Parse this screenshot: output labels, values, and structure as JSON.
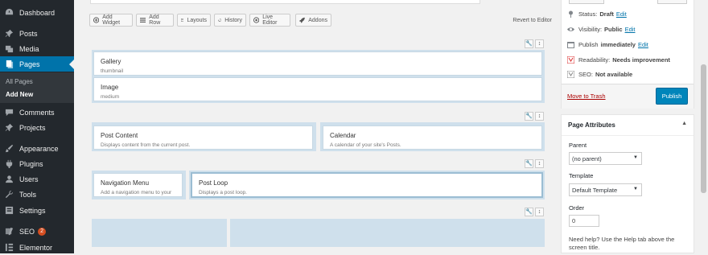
{
  "sidebar": {
    "items": [
      {
        "label": "Dashboard",
        "icon": "dashboard-icon"
      },
      {
        "label": "Posts",
        "icon": "pin-icon"
      },
      {
        "label": "Media",
        "icon": "media-icon"
      },
      {
        "label": "Pages",
        "icon": "pages-icon"
      },
      {
        "label": "Comments",
        "icon": "comments-icon"
      },
      {
        "label": "Projects",
        "icon": "pin-icon"
      },
      {
        "label": "Appearance",
        "icon": "brush-icon"
      },
      {
        "label": "Plugins",
        "icon": "plugin-icon"
      },
      {
        "label": "Users",
        "icon": "users-icon"
      },
      {
        "label": "Tools",
        "icon": "wrench-icon"
      },
      {
        "label": "Settings",
        "icon": "settings-icon"
      },
      {
        "label": "SEO",
        "icon": "seo-icon",
        "badge": "2"
      },
      {
        "label": "Elementor",
        "icon": "elementor-icon"
      }
    ],
    "submenu": [
      "All Pages",
      "Add New"
    ]
  },
  "toolbar": {
    "add_widget": "Add Widget",
    "add_row": "Add Row",
    "layouts": "Layouts",
    "history": "History",
    "live_editor": "Live Editor",
    "addons": "Addons",
    "revert": "Revert to Editor"
  },
  "rows": {
    "r1": {
      "w1": {
        "title": "Gallery",
        "desc": "thumbnail"
      },
      "w2": {
        "title": "Image",
        "desc": "medium"
      }
    },
    "r2": {
      "w1": {
        "title": "Post Content",
        "desc": "Displays content from the current post."
      },
      "w2": {
        "title": "Calendar",
        "desc": "A calendar of your site's Posts."
      }
    },
    "r3": {
      "w1": {
        "title": "Navigation Menu",
        "desc": "Add a navigation menu to your"
      },
      "w2": {
        "title": "Post Loop",
        "desc": "Displays a post loop."
      }
    }
  },
  "publish": {
    "status_label": "Status:",
    "status_value": "Draft",
    "edit": "Edit",
    "visibility_label": "Visibility:",
    "visibility_value": "Public",
    "publish_label": "Publish",
    "publish_value": "immediately",
    "readability_label": "Readability:",
    "readability_value": "Needs improvement",
    "seo_label": "SEO:",
    "seo_value": "Not available",
    "trash": "Move to Trash",
    "publish_button": "Publish"
  },
  "attributes": {
    "title": "Page Attributes",
    "toggle": "▲",
    "parent_label": "Parent",
    "parent_value": "(no parent)",
    "template_label": "Template",
    "template_value": "Default Template",
    "order_label": "Order",
    "order_value": "0",
    "help": "Need help? Use the Help tab above the screen title."
  },
  "colors": {
    "sidebar_bg": "#23282d",
    "accent": "#0073aa",
    "cell": "#cfe0ec"
  }
}
